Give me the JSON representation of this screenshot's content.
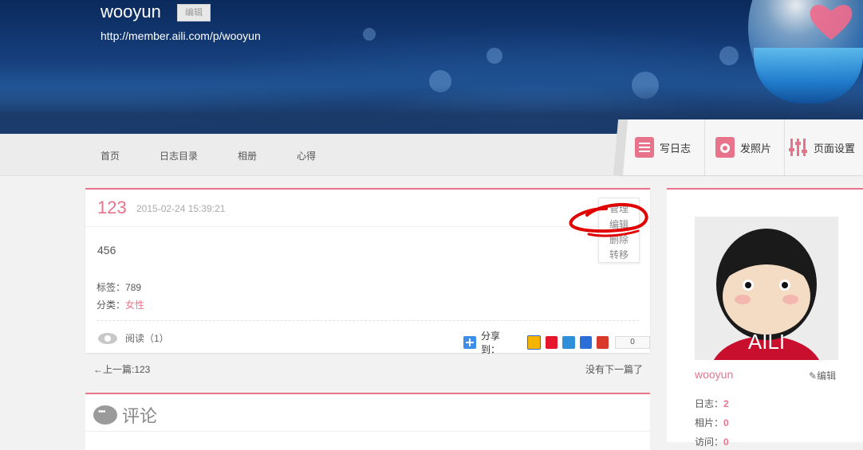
{
  "header": {
    "site_name": "wooyun",
    "edit_badge": "编辑",
    "url": "http://member.aili.com/p/wooyun"
  },
  "nav": [
    "首页",
    "日志目录",
    "相册",
    "心得"
  ],
  "toolbar": {
    "write_log": "写日志",
    "post_photo": "发照片",
    "page_settings": "页面设置"
  },
  "post": {
    "title": "123",
    "date": "2015-02-24 15:39:21",
    "manage_menu": [
      "管理",
      "编辑",
      "删除",
      "转移"
    ],
    "body": "456",
    "tags_label": "标签：",
    "tags_value": "789",
    "category_label": "分类：",
    "category_value": "女性",
    "read_text": "阅读（1）",
    "share_label": "分享到：",
    "share_count": "0"
  },
  "pager": {
    "prev": "←上一篇:123",
    "next": "没有下一篇了"
  },
  "comments": {
    "title": "评论"
  },
  "sidebar": {
    "avatar_text": "AILI",
    "username": "wooyun",
    "edit": "编辑",
    "stats": [
      {
        "label": "日志：",
        "value": "2"
      },
      {
        "label": "相片：",
        "value": "0"
      },
      {
        "label": "访问：",
        "value": "0"
      }
    ]
  },
  "colors": {
    "accent": "#e8748c",
    "banner": "#163f7c",
    "annotation": "#e00000"
  }
}
